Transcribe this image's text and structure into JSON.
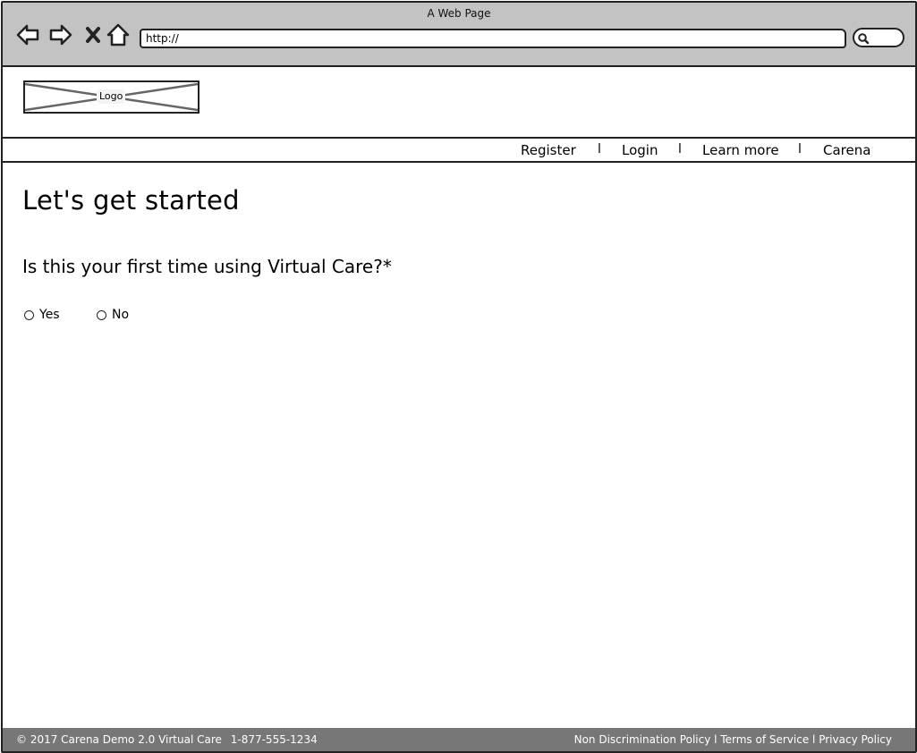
{
  "window": {
    "title": "A Web Page"
  },
  "browser": {
    "url": "http://",
    "icons": [
      "back-arrow-icon",
      "forward-arrow-icon",
      "close-icon",
      "home-icon",
      "search-icon"
    ]
  },
  "header": {
    "logo_label": "Logo",
    "nav": {
      "register": "Register",
      "login": "Login",
      "learn_more": "Learn more",
      "carena": "Carena",
      "separator": "l"
    }
  },
  "main": {
    "title": "Let's get started",
    "question": "Is this your first time using Virtual Care?*",
    "options": {
      "yes": "Yes",
      "no": "No"
    }
  },
  "footer": {
    "copyright": "© 2017 Carena Demo 2.0 Virtual Care",
    "phone": "1-877-555-1234",
    "non_discrimination": "Non Discrimination Policy",
    "terms": "Terms of Service",
    "privacy": "Privacy Policy",
    "separator": "l"
  },
  "colors": {
    "chrome_bg": "#c3c3c3",
    "footer_bg": "#777777",
    "border": "#222222"
  }
}
